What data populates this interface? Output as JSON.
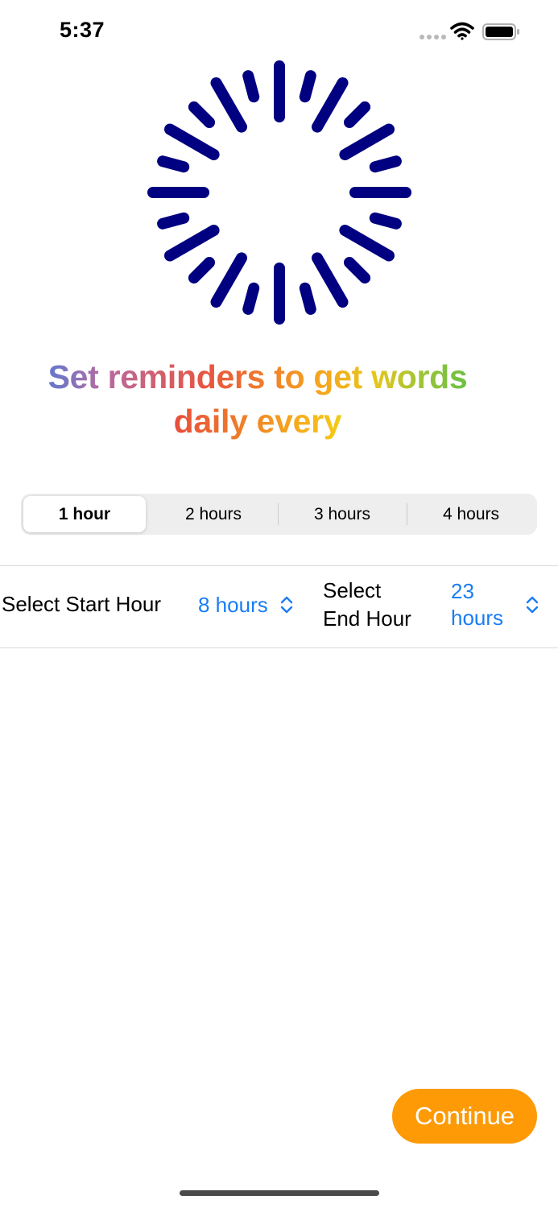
{
  "status_bar": {
    "time": "5:37",
    "icons": [
      "cellular-dots-icon",
      "wifi-icon",
      "battery-icon"
    ]
  },
  "illustration": {
    "icon": "sunburst-icon",
    "color": "#000080"
  },
  "headline": {
    "line1": "Set reminders to get words",
    "line2": "daily every"
  },
  "interval_selector": {
    "options": [
      "1 hour",
      "2 hours",
      "3 hours",
      "4 hours"
    ],
    "selected_index": 0
  },
  "start_hour": {
    "label": "Select Start Hour",
    "value": "8 hours",
    "icon": "up-down-chevron-icon"
  },
  "end_hour": {
    "label_line1": "Select",
    "label_line2": "End Hour",
    "value_line1": "23",
    "value_line2": "hours",
    "icon": "up-down-chevron-icon"
  },
  "continue_button": {
    "label": "Continue",
    "color": "#fd9a05"
  },
  "accent_color": "#1a7cf5"
}
